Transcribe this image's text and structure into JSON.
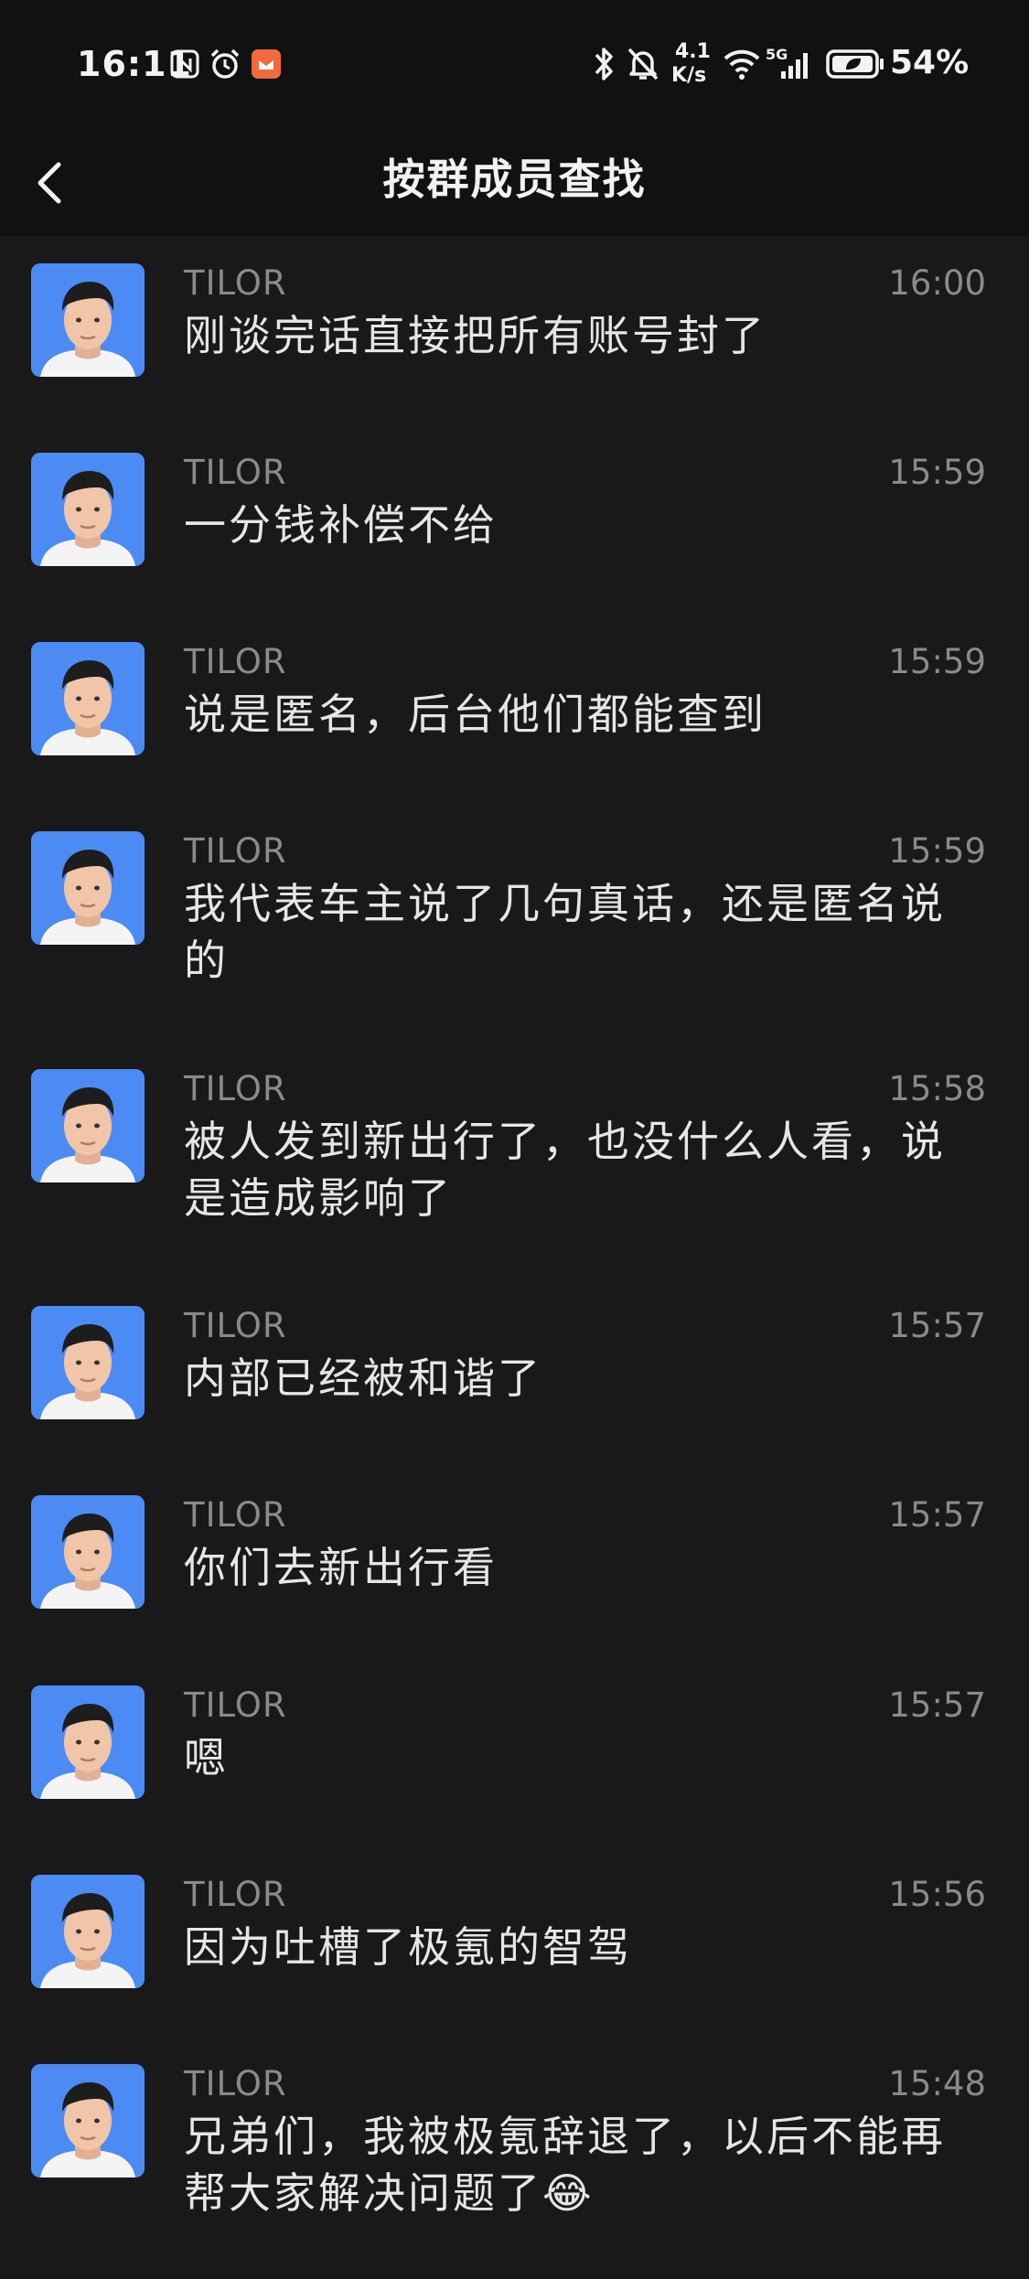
{
  "status_bar": {
    "time": "16:11",
    "network_speed_value": "4.1",
    "network_speed_unit": "K/s",
    "network_type": "5G",
    "battery": "54%"
  },
  "header": {
    "title": "按群成员查找",
    "back_icon": "chevron-left-icon"
  },
  "messages": [
    {
      "sender": "TILOR",
      "time": "16:00",
      "text": "刚谈完话直接把所有账号封了"
    },
    {
      "sender": "TILOR",
      "time": "15:59",
      "text": "一分钱补偿不给"
    },
    {
      "sender": "TILOR",
      "time": "15:59",
      "text": "说是匿名，后台他们都能查到"
    },
    {
      "sender": "TILOR",
      "time": "15:59",
      "text": "我代表车主说了几句真话，还是匿名说的"
    },
    {
      "sender": "TILOR",
      "time": "15:58",
      "text": "被人发到新出行了，也没什么人看，说是造成影响了"
    },
    {
      "sender": "TILOR",
      "time": "15:57",
      "text": "内部已经被和谐了"
    },
    {
      "sender": "TILOR",
      "time": "15:57",
      "text": "你们去新出行看"
    },
    {
      "sender": "TILOR",
      "time": "15:57",
      "text": "嗯"
    },
    {
      "sender": "TILOR",
      "time": "15:56",
      "text": "因为吐槽了极氪的智驾"
    },
    {
      "sender": "TILOR",
      "time": "15:48",
      "text": "兄弟们，我被极氪辞退了，以后不能再帮大家解决问题了😂"
    }
  ],
  "colors": {
    "background": "#191919",
    "header_background": "#111111",
    "avatar_background": "#4c8bf3",
    "meta_text": "#8a8a8a",
    "message_text": "#e6e6e6"
  }
}
